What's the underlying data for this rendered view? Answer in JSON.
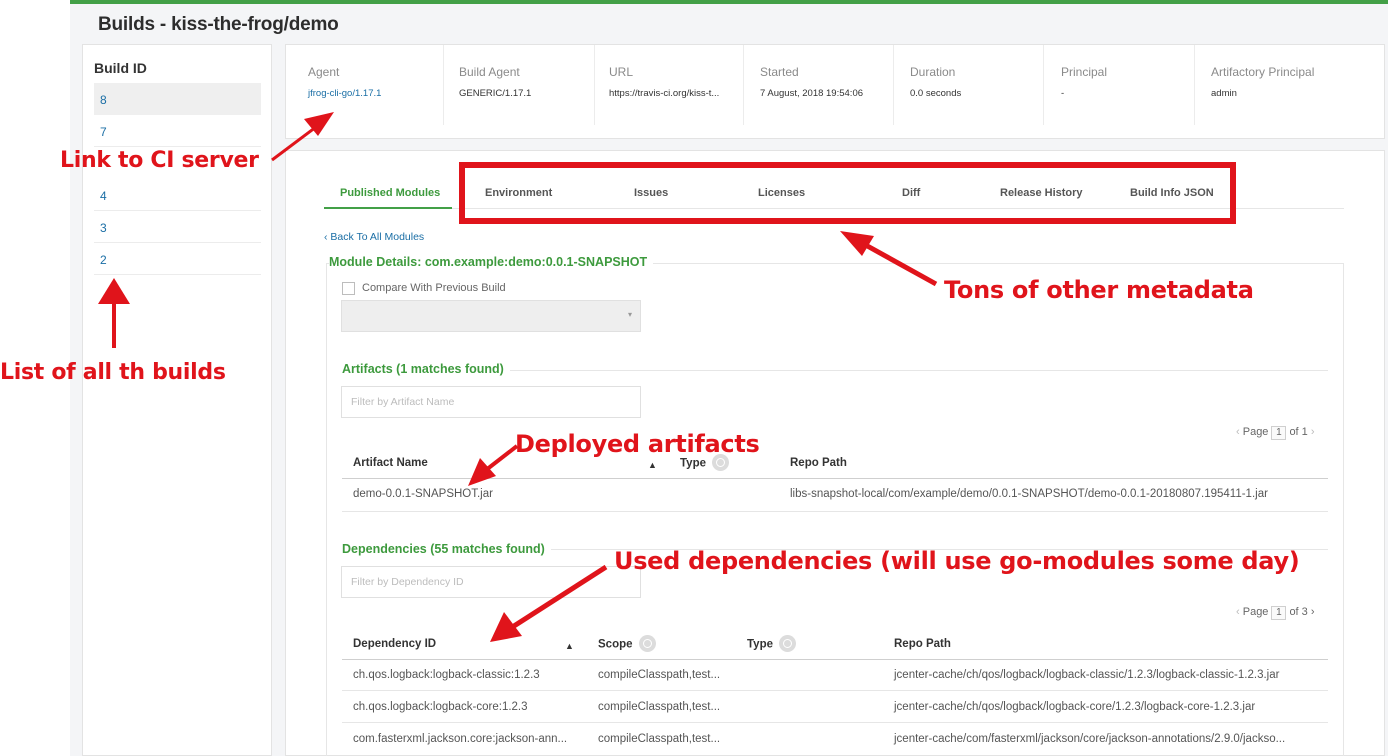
{
  "page": {
    "title": "Builds - kiss-the-frog/demo"
  },
  "sidebar": {
    "heading": "Build ID",
    "builds": [
      "8",
      "7",
      "4",
      "3",
      "2"
    ]
  },
  "build_info": [
    {
      "label": "Agent",
      "value": "jfrog-cli-go/1.17.1"
    },
    {
      "label": "Build Agent",
      "value": "GENERIC/1.17.1"
    },
    {
      "label": "URL",
      "value": "https://travis-ci.org/kiss-t..."
    },
    {
      "label": "Started",
      "value": "7 August, 2018 19:54:06"
    },
    {
      "label": "Duration",
      "value": "0.0 seconds"
    },
    {
      "label": "Principal",
      "value": "-"
    },
    {
      "label": "Artifactory Principal",
      "value": "admin"
    }
  ],
  "tabs": [
    "Published Modules",
    "Environment",
    "Issues",
    "Licenses",
    "Diff",
    "Release History",
    "Build Info JSON"
  ],
  "module": {
    "back_link": "‹ Back To All Modules",
    "title": "Module Details: com.example:demo:0.0.1-SNAPSHOT",
    "compare_label": "Compare With Previous Build",
    "caret": "▾"
  },
  "artifacts": {
    "title": "Artifacts (1 matches found)",
    "filter_placeholder": "Filter by Artifact Name",
    "pager": {
      "prefix": "Page",
      "current": "1",
      "suffix": "of 1"
    },
    "columns": [
      "Artifact Name",
      "Type",
      "Repo Path"
    ],
    "rows": [
      {
        "name": "demo-0.0.1-SNAPSHOT.jar",
        "type": "",
        "repo_path": "libs-snapshot-local/com/example/demo/0.0.1-SNAPSHOT/demo-0.0.1-20180807.195411-1.jar"
      }
    ]
  },
  "dependencies": {
    "title": "Dependencies (55 matches found)",
    "filter_placeholder": "Filter by Dependency ID",
    "pager": {
      "prefix": "Page",
      "current": "1",
      "suffix": "of 3"
    },
    "columns": [
      "Dependency ID",
      "Scope",
      "Type",
      "Repo Path"
    ],
    "rows": [
      {
        "id": "ch.qos.logback:logback-classic:1.2.3",
        "scope": "compileClasspath,test...",
        "repo_path": "jcenter-cache/ch/qos/logback/logback-classic/1.2.3/logback-classic-1.2.3.jar"
      },
      {
        "id": "ch.qos.logback:logback-core:1.2.3",
        "scope": "compileClasspath,test...",
        "repo_path": "jcenter-cache/ch/qos/logback/logback-core/1.2.3/logback-core-1.2.3.jar"
      },
      {
        "id": "com.fasterxml.jackson.core:jackson-ann...",
        "scope": "compileClasspath,test...",
        "repo_path": "jcenter-cache/com/fasterxml/jackson/core/jackson-annotations/2.9.0/jackso..."
      }
    ]
  },
  "annotations": {
    "ci_link": "Link to CI server",
    "metadata": "Tons of other metadata",
    "builds_list": "List of all th builds",
    "artifacts": "Deployed artifacts",
    "dependencies": "Used dependencies (will use go-modules some day)"
  },
  "colors": {
    "accent_green": "#43a047",
    "link_blue": "#1a6ea5",
    "annotation_red": "#e0141b"
  }
}
